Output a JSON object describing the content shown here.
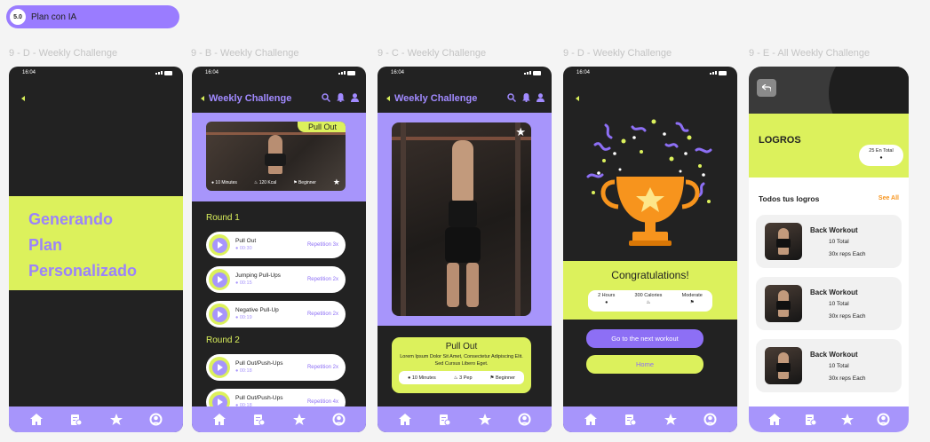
{
  "badge": {
    "number": "5.0",
    "title": "Plan con IA"
  },
  "frames": [
    {
      "label": "9 - D - Weekly Challenge",
      "time": "16:04"
    },
    {
      "label": "9 - B - Weekly Challenge",
      "time": "16:04"
    },
    {
      "label": "9 - C - Weekly Challenge",
      "time": "16:04"
    },
    {
      "label": "9 - D - Weekly Challenge",
      "time": "16:04"
    },
    {
      "label": "9 - E - All Weekly Challenge"
    }
  ],
  "screen1": {
    "lines": [
      "Generando",
      "Plan",
      "Personalizado"
    ]
  },
  "screen2": {
    "title": "Weekly Challenge",
    "hero": {
      "tag": "Pull Out",
      "stats": [
        "10 Minutes",
        "120 Kcal",
        "Beginner"
      ]
    },
    "rounds": [
      {
        "name": "Round 1",
        "items": [
          {
            "name": "Pull Out",
            "time": "00:30",
            "reps": "Repetition 3x"
          },
          {
            "name": "Jumping Pull-Ups",
            "time": "00:15",
            "reps": "Repetition 2x"
          },
          {
            "name": "Negative Pull-Up",
            "time": "00:19",
            "reps": "Repetition 2x"
          }
        ]
      },
      {
        "name": "Round 2",
        "items": [
          {
            "name": "Pull Out/Push-Ups",
            "time": "00:18",
            "reps": "Repetition 2x"
          },
          {
            "name": "Pull Out/Push-Ups",
            "time": "00:18",
            "reps": "Repetition 4x"
          }
        ]
      }
    ]
  },
  "screen3": {
    "title": "Weekly Challenge",
    "card": {
      "title": "Pull Out",
      "desc": "Lorem Ipsum Dolor Sit Amet, Consectetur Adipiscing Elit. Sed Cursus Libero Eget.",
      "stats": [
        "10 Minutes",
        "3 Pep",
        "Beginner"
      ]
    }
  },
  "screen4": {
    "congrats": "Congratulations!",
    "stats": [
      "2 Hours",
      "300 Calories",
      "Moderate"
    ],
    "primary": "Go to the next workout",
    "secondary": "Home"
  },
  "screen5": {
    "title": "LOGROS",
    "total": "25 En Total",
    "section": "Todos tus logros",
    "see_all": "See All",
    "items": [
      {
        "name": "Back Workout",
        "count": "10 Total",
        "reps": "30x reps Each"
      },
      {
        "name": "Back Workout",
        "count": "10 Total",
        "reps": "30x reps Each"
      },
      {
        "name": "Back Workout",
        "count": "10 Total",
        "reps": "30x reps Each"
      }
    ]
  },
  "colors": {
    "lime": "#dcf15c",
    "purple": "#a795fb",
    "dark": "#222222",
    "orange": "#f7941d"
  }
}
